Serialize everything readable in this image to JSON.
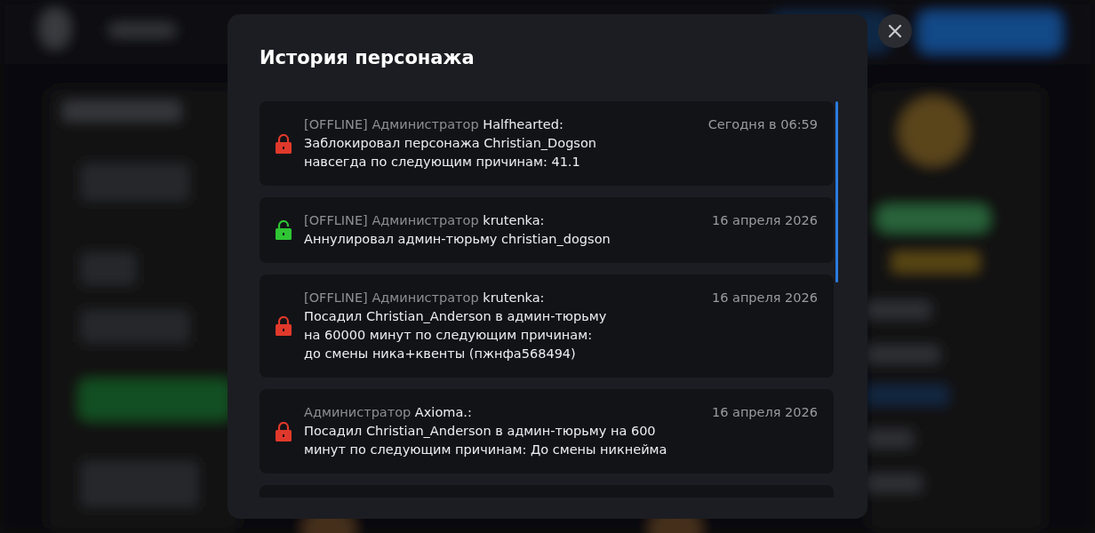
{
  "modal": {
    "title": "История персонажа",
    "entries": [
      {
        "kind": "locked",
        "header": "[OFFLINE] Администратор **Halfhearted:**",
        "lines": [
          "Заблокировал персонажа Christian_Dogson",
          "навсегда по следующим причинам: 41.1"
        ],
        "date": "Сегодня в 06:59"
      },
      {
        "kind": "unlocked",
        "header": "[OFFLINE] Администратор **krutenka:**",
        "lines": [
          "Аннулировал админ-тюрьму christian_dogson"
        ],
        "date": "16 апреля 2026"
      },
      {
        "kind": "locked",
        "header": "[OFFLINE] Администратор **krutenka:**",
        "lines": [
          "Посадил Christian_Anderson в админ-тюрьму",
          "на 60000 минут по следующим причинам:",
          "до смены ника+квенты (пжнфа568494)"
        ],
        "date": "16 апреля 2026"
      },
      {
        "kind": "locked",
        "header": "Администратор **Axioma.:**",
        "lines": [
          "Посадил Christian_Anderson в админ-тюрьму на 600",
          "минут по следующим причинам: До смены никнейма"
        ],
        "date": "16 апреля 2026"
      }
    ]
  }
}
